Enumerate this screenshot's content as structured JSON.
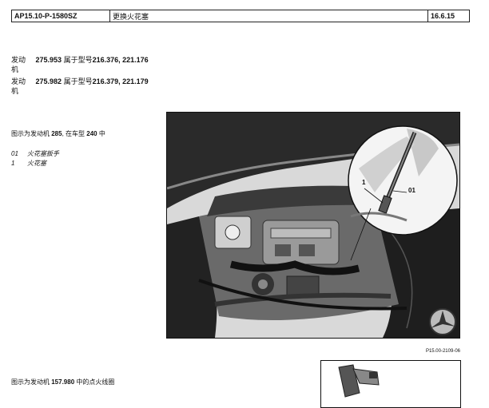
{
  "header": {
    "code": "AP15.10-P-1580SZ",
    "title": "更换火花塞",
    "date": "16.6.15"
  },
  "engines": [
    {
      "label": "发动",
      "label_cont": "机",
      "code": "275.953",
      "model_text": "属于型号",
      "models": "216.376, 221.176"
    },
    {
      "label": "发动",
      "label_cont": "机",
      "code": "275.982",
      "model_text": "属于型号",
      "models": "216.379, 221.179"
    }
  ],
  "figure1": {
    "caption_prefix": "图示为发动机",
    "engine": "285",
    "caption_mid": ", 在车型",
    "vehicle": "240",
    "caption_suffix": "中",
    "callouts": [
      "1",
      "01"
    ],
    "ref": "P15.00-2109-06"
  },
  "legend": [
    {
      "num": "01",
      "text": "火花塞扳手"
    },
    {
      "num": "1",
      "text": "火花塞"
    }
  ],
  "figure2": {
    "caption_prefix": "图示为发动机",
    "engine": "157.980",
    "caption_suffix": "中的点火线圈"
  }
}
